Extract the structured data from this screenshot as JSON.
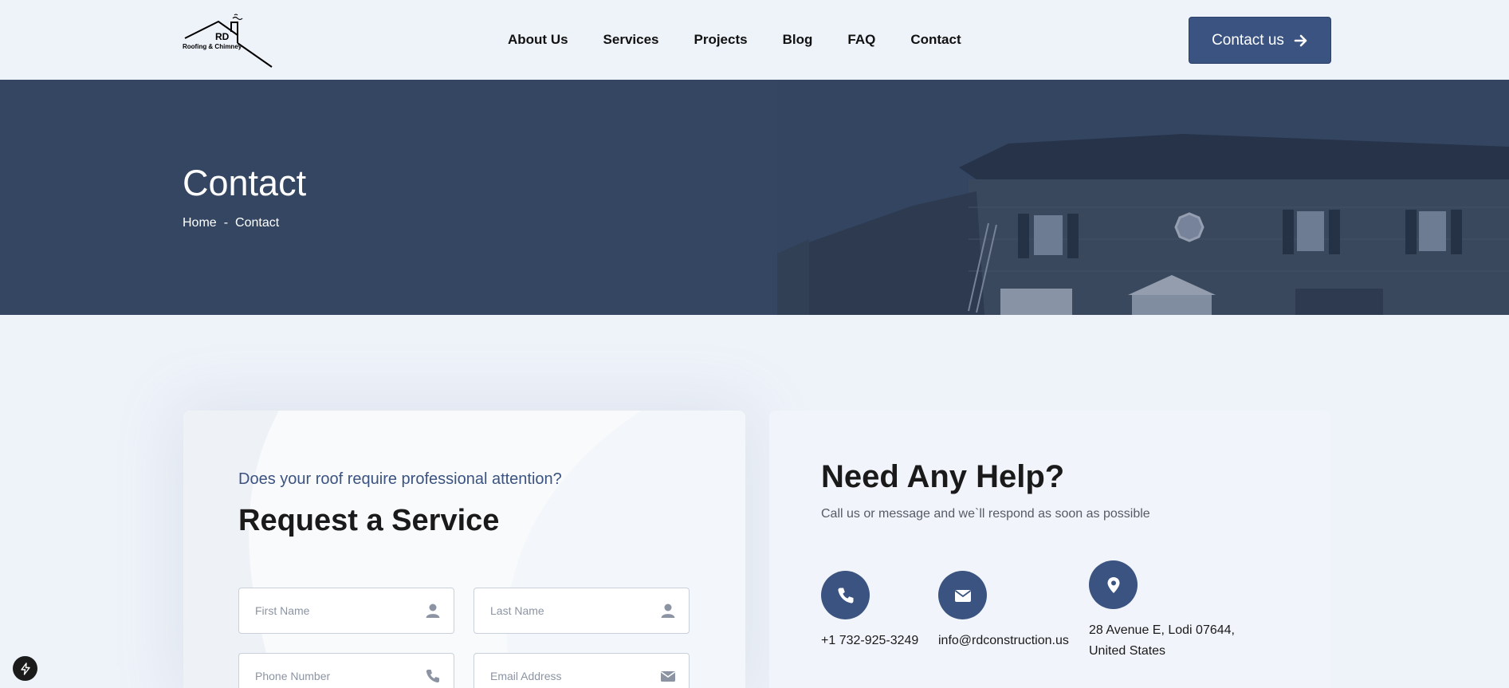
{
  "brand": {
    "logo_main": "RD",
    "logo_sub": "Roofing & Chimney"
  },
  "nav": {
    "items": [
      {
        "label": "About Us"
      },
      {
        "label": "Services"
      },
      {
        "label": "Projects"
      },
      {
        "label": "Blog"
      },
      {
        "label": "FAQ"
      },
      {
        "label": "Contact"
      }
    ],
    "cta_label": "Contact us"
  },
  "hero": {
    "title": "Contact",
    "breadcrumb": {
      "home": "Home",
      "separator": "-",
      "current": "Contact"
    }
  },
  "request_form": {
    "kicker": "Does your roof require professional attention?",
    "title": "Request a Service",
    "fields": {
      "first_name_placeholder": "First Name",
      "last_name_placeholder": "Last Name",
      "phone_placeholder": "Phone Number",
      "email_placeholder": "Email Address"
    }
  },
  "help": {
    "title": "Need Any Help?",
    "subtitle": "Call us or message and we`ll respond as soon as possible",
    "phone": "+1 732-925-3249",
    "email": "info@rdconstruction.us",
    "address_line1": "28 Avenue E, Lodi 07644,",
    "address_line2": "United States"
  },
  "colors": {
    "accent": "#3a5380",
    "hero_bg": "#344661",
    "page_bg": "#eef2f9"
  },
  "icons": [
    "user-icon",
    "phone-icon",
    "envelope-icon",
    "map-pin-icon",
    "arrow-right-icon",
    "bolt-icon"
  ]
}
